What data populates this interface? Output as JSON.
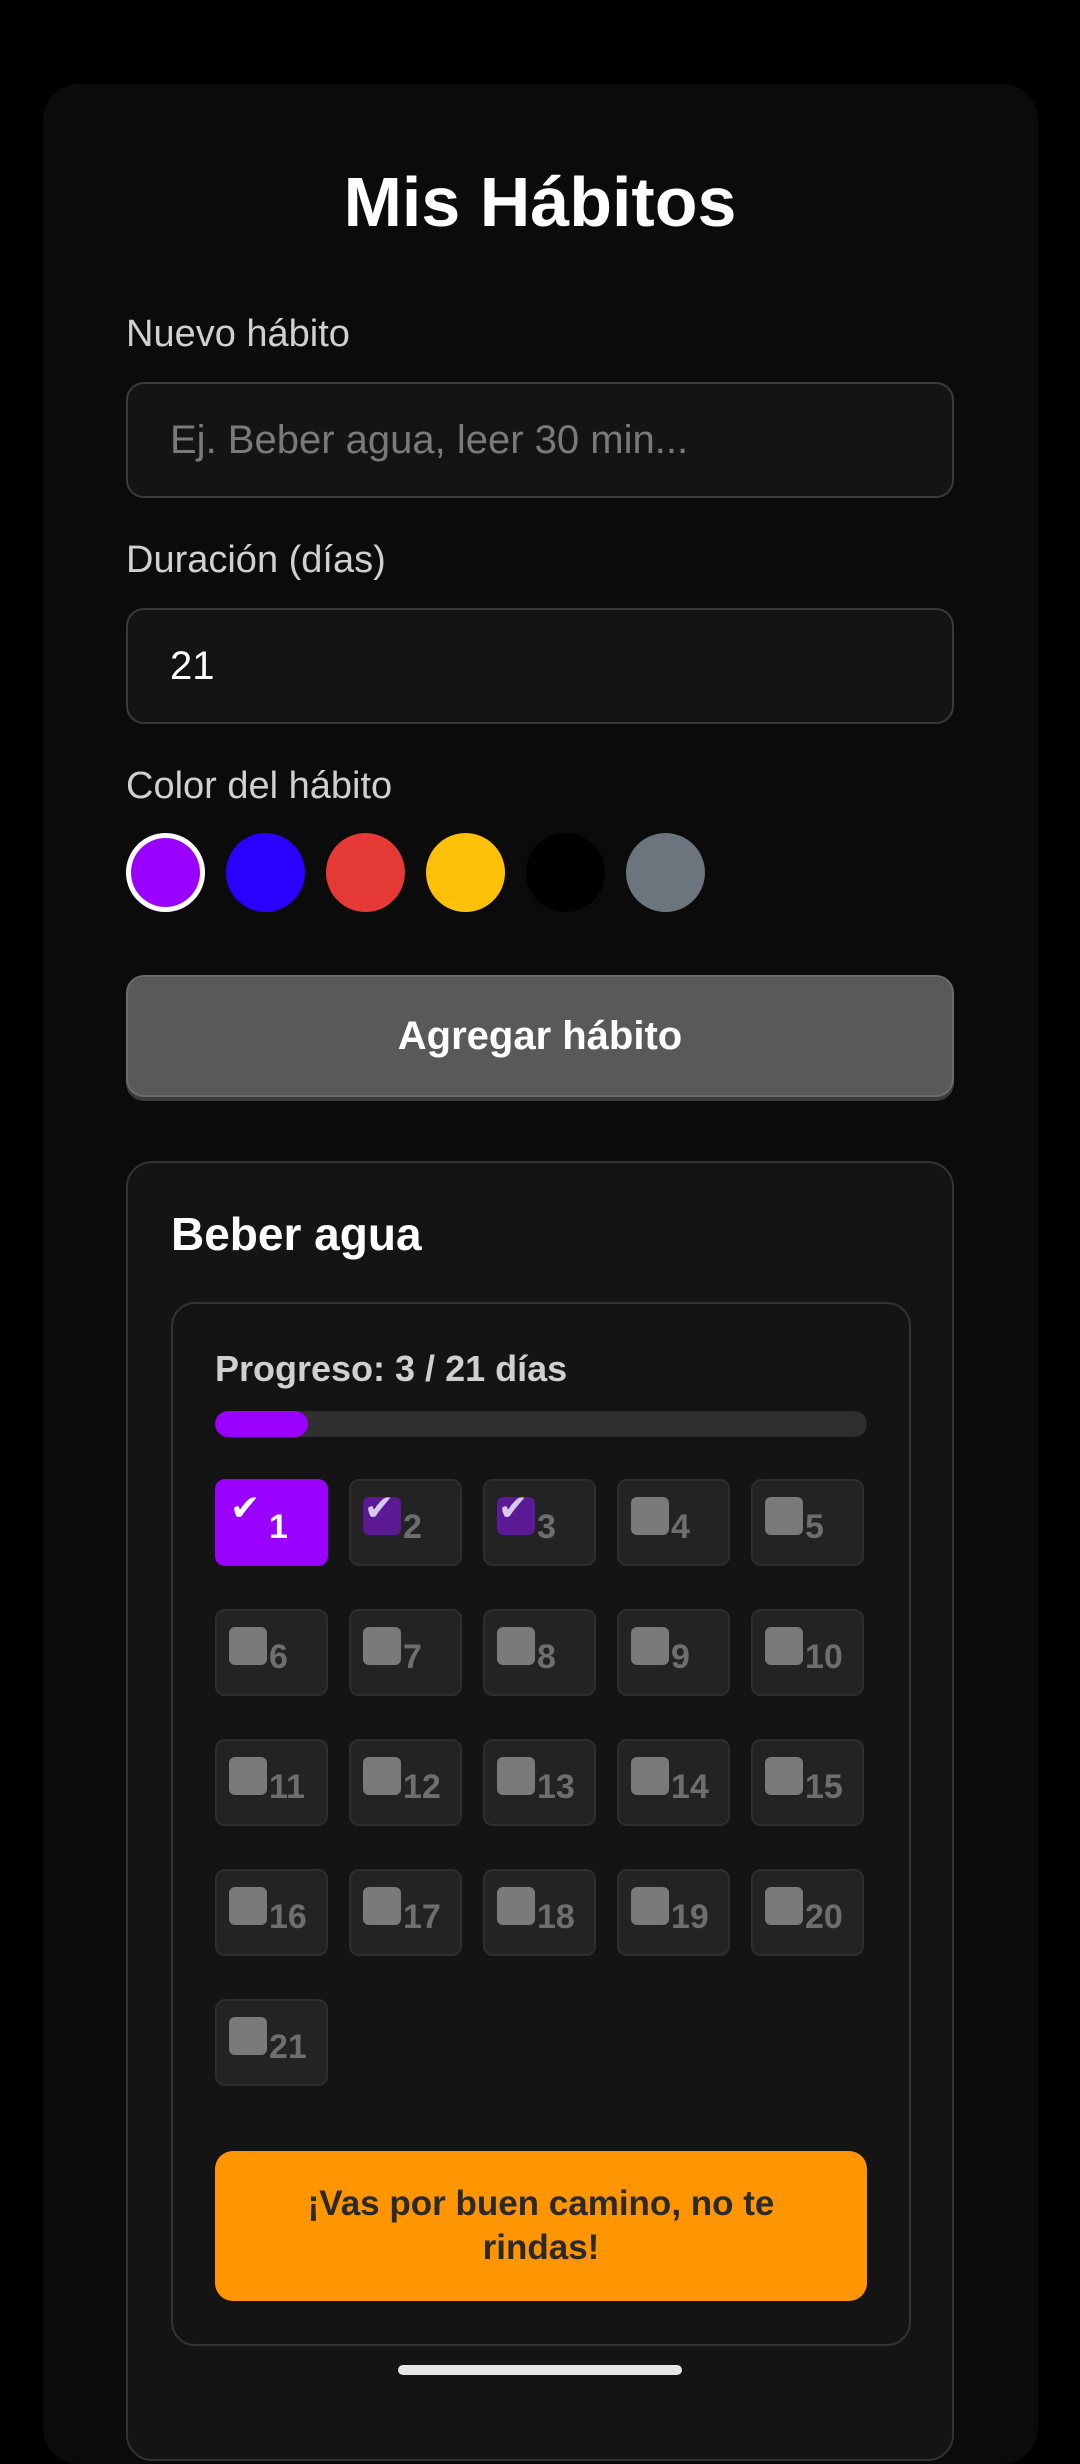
{
  "title": "Mis Hábitos",
  "form": {
    "habit_label": "Nuevo hábito",
    "habit_placeholder": "Ej. Beber agua, leer 30 min...",
    "duration_label": "Duración (días)",
    "duration_value": "21",
    "color_label": "Color del hábito",
    "colors": [
      "#9900ff",
      "#2b00ff",
      "#e53935",
      "#ffc107",
      "#000000",
      "#6c757d"
    ],
    "selected_color": "#9900ff",
    "add_button": "Agregar hábito"
  },
  "habit": {
    "name": "Beber agua",
    "progress_text": "Progreso: 3 / 21 días",
    "completed": 3,
    "total": 21,
    "color": "#9900ff",
    "days": [
      {
        "n": "1",
        "state": "today"
      },
      {
        "n": "2",
        "state": "checked"
      },
      {
        "n": "3",
        "state": "checked"
      },
      {
        "n": "4",
        "state": "empty"
      },
      {
        "n": "5",
        "state": "empty"
      },
      {
        "n": "6",
        "state": "empty"
      },
      {
        "n": "7",
        "state": "empty"
      },
      {
        "n": "8",
        "state": "empty"
      },
      {
        "n": "9",
        "state": "empty"
      },
      {
        "n": "10",
        "state": "empty"
      },
      {
        "n": "11",
        "state": "empty"
      },
      {
        "n": "12",
        "state": "empty"
      },
      {
        "n": "13",
        "state": "empty"
      },
      {
        "n": "14",
        "state": "empty"
      },
      {
        "n": "15",
        "state": "empty"
      },
      {
        "n": "16",
        "state": "empty"
      },
      {
        "n": "17",
        "state": "empty"
      },
      {
        "n": "18",
        "state": "empty"
      },
      {
        "n": "19",
        "state": "empty"
      },
      {
        "n": "20",
        "state": "empty"
      },
      {
        "n": "21",
        "state": "empty"
      }
    ],
    "motivation": "¡Vas por buen camino, no te rindas!",
    "icons": [
      "edit-icon",
      "delete-icon"
    ]
  }
}
